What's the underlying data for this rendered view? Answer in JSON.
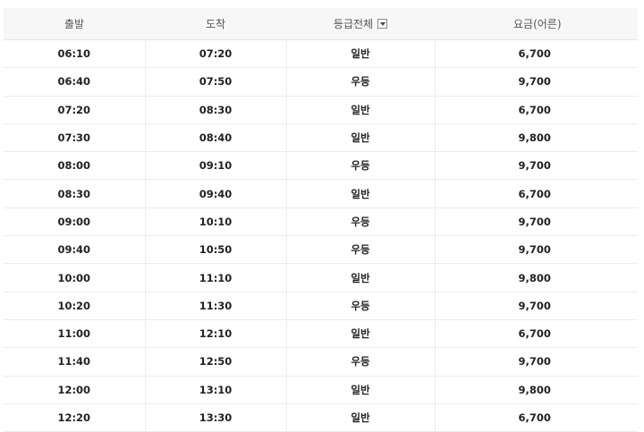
{
  "header": {
    "departure": "출발",
    "arrival": "도착",
    "grade_filter": "등급전체",
    "fare": "요금(어른)"
  },
  "rows": [
    {
      "departure": "06:10",
      "arrival": "07:20",
      "grade": "일반",
      "fare": "6,700"
    },
    {
      "departure": "06:40",
      "arrival": "07:50",
      "grade": "우등",
      "fare": "9,700"
    },
    {
      "departure": "07:20",
      "arrival": "08:30",
      "grade": "일반",
      "fare": "6,700"
    },
    {
      "departure": "07:30",
      "arrival": "08:40",
      "grade": "일반",
      "fare": "9,800"
    },
    {
      "departure": "08:00",
      "arrival": "09:10",
      "grade": "우등",
      "fare": "9,700"
    },
    {
      "departure": "08:30",
      "arrival": "09:40",
      "grade": "일반",
      "fare": "6,700"
    },
    {
      "departure": "09:00",
      "arrival": "10:10",
      "grade": "우등",
      "fare": "9,700"
    },
    {
      "departure": "09:40",
      "arrival": "10:50",
      "grade": "우등",
      "fare": "9,700"
    },
    {
      "departure": "10:00",
      "arrival": "11:10",
      "grade": "일반",
      "fare": "9,800"
    },
    {
      "departure": "10:20",
      "arrival": "11:30",
      "grade": "우등",
      "fare": "9,700"
    },
    {
      "departure": "11:00",
      "arrival": "12:10",
      "grade": "일반",
      "fare": "6,700"
    },
    {
      "departure": "11:40",
      "arrival": "12:50",
      "grade": "우등",
      "fare": "9,700"
    },
    {
      "departure": "12:00",
      "arrival": "13:10",
      "grade": "일반",
      "fare": "9,800"
    },
    {
      "departure": "12:20",
      "arrival": "13:30",
      "grade": "일반",
      "fare": "6,700"
    }
  ],
  "icons": {
    "grade_dropdown": "dropdown-arrow-icon"
  }
}
